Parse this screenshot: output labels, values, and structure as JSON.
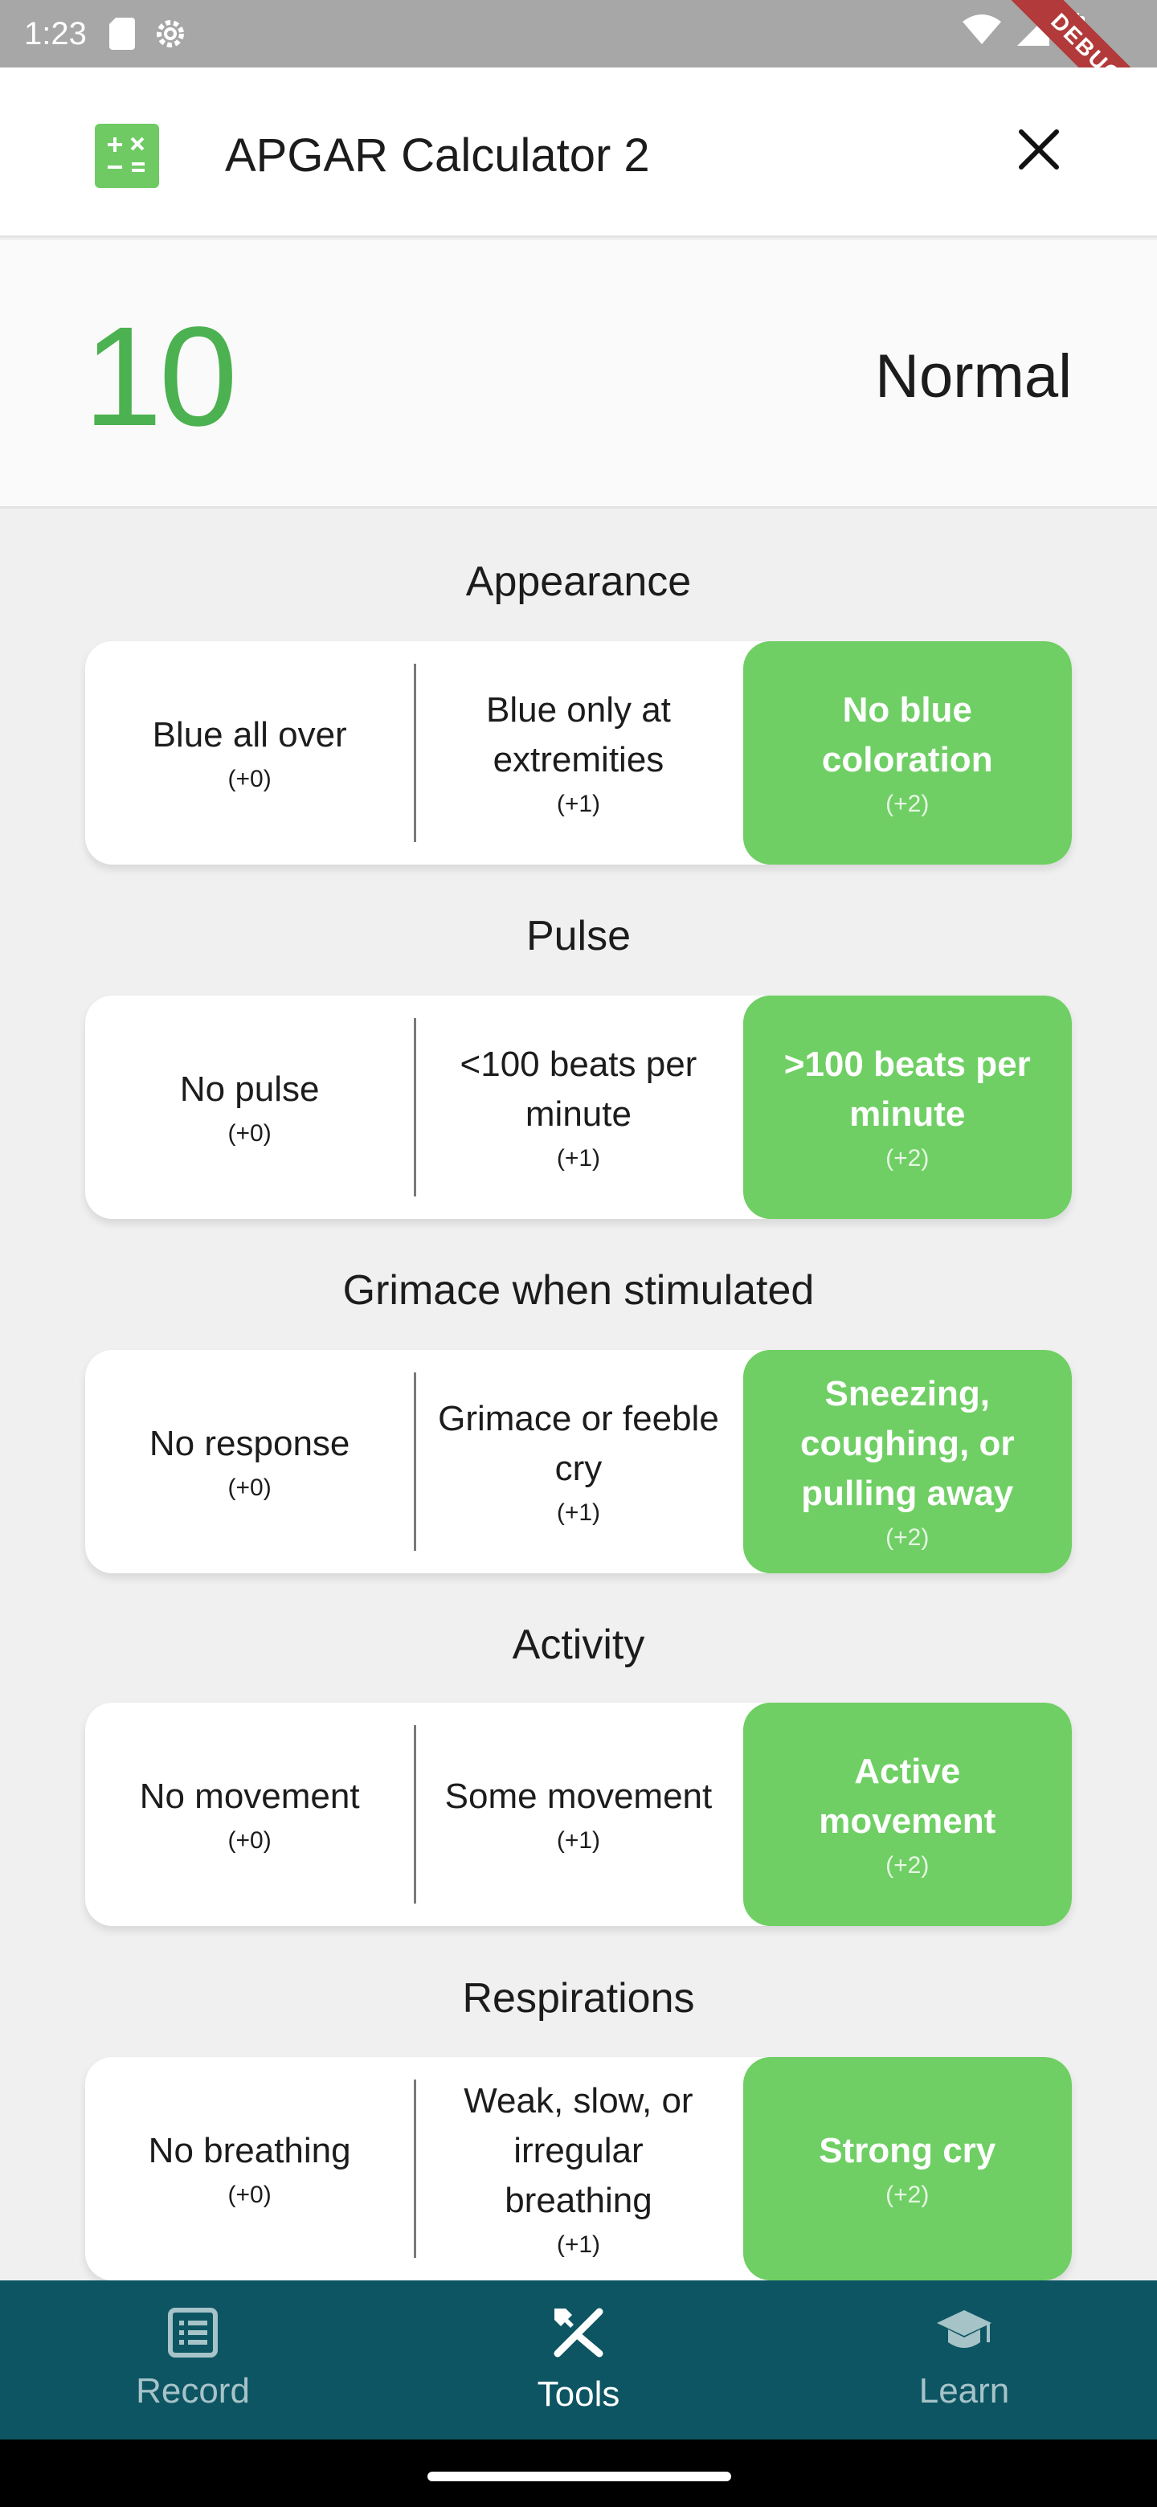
{
  "status_bar": {
    "time": "1:23",
    "debug_banner": "DEBUG"
  },
  "app_bar": {
    "title": "APGAR Calculator 2",
    "icon": "calculator-icon",
    "close_icon": "close-icon"
  },
  "score": {
    "value": "10",
    "status": "Normal",
    "color": "#4cb150"
  },
  "sections": [
    {
      "title": "Appearance",
      "options": [
        {
          "label": "Blue all over",
          "points": "(+0)"
        },
        {
          "label": "Blue only at extremities",
          "points": "(+1)"
        },
        {
          "label": "No blue coloration",
          "points": "(+2)"
        }
      ],
      "selected": 2
    },
    {
      "title": "Pulse",
      "options": [
        {
          "label": "No pulse",
          "points": "(+0)"
        },
        {
          "label": "<100 beats per minute",
          "points": "(+1)"
        },
        {
          "label": ">100 beats per minute",
          "points": "(+2)"
        }
      ],
      "selected": 2
    },
    {
      "title": "Grimace when stimulated",
      "options": [
        {
          "label": "No response",
          "points": "(+0)"
        },
        {
          "label": "Grimace or feeble cry",
          "points": "(+1)"
        },
        {
          "label": "Sneezing, coughing, or pulling away",
          "points": "(+2)"
        }
      ],
      "selected": 2
    },
    {
      "title": "Activity",
      "options": [
        {
          "label": "No movement",
          "points": "(+0)"
        },
        {
          "label": "Some movement",
          "points": "(+1)"
        },
        {
          "label": "Active movement",
          "points": "(+2)"
        }
      ],
      "selected": 2
    },
    {
      "title": "Respirations",
      "options": [
        {
          "label": "No breathing",
          "points": "(+0)"
        },
        {
          "label": "Weak, slow, or irregular breathing",
          "points": "(+1)"
        },
        {
          "label": "Strong cry",
          "points": "(+2)"
        }
      ],
      "selected": 2
    }
  ],
  "bottom_nav": {
    "items": [
      {
        "label": "Record",
        "icon": "list-icon",
        "active": false
      },
      {
        "label": "Tools",
        "icon": "tools-icon",
        "active": true
      },
      {
        "label": "Learn",
        "icon": "graduation-cap-icon",
        "active": false
      }
    ]
  },
  "colors": {
    "accent_green": "#6fcf64",
    "score_green": "#4cb150",
    "nav_background": "#0d5563"
  }
}
